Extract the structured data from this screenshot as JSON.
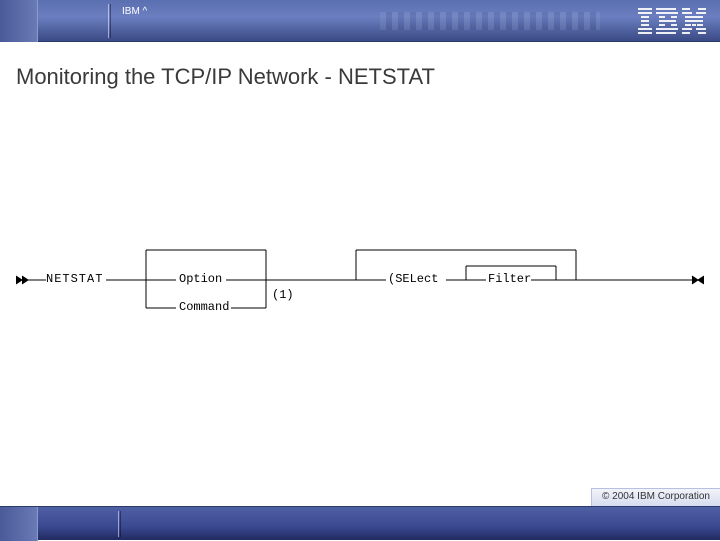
{
  "header": {
    "brand_label": "IBM ^",
    "logo_name": "ibm-logo"
  },
  "title": "Monitoring the TCP/IP Network - NETSTAT",
  "syntax": {
    "command": "NETSTAT",
    "branch_option": "Option",
    "branch_command": "Command",
    "footnote": "(1)",
    "select_keyword": "(SELect",
    "filter_label": "Filter"
  },
  "copyright": "© 2004 IBM Corporation"
}
